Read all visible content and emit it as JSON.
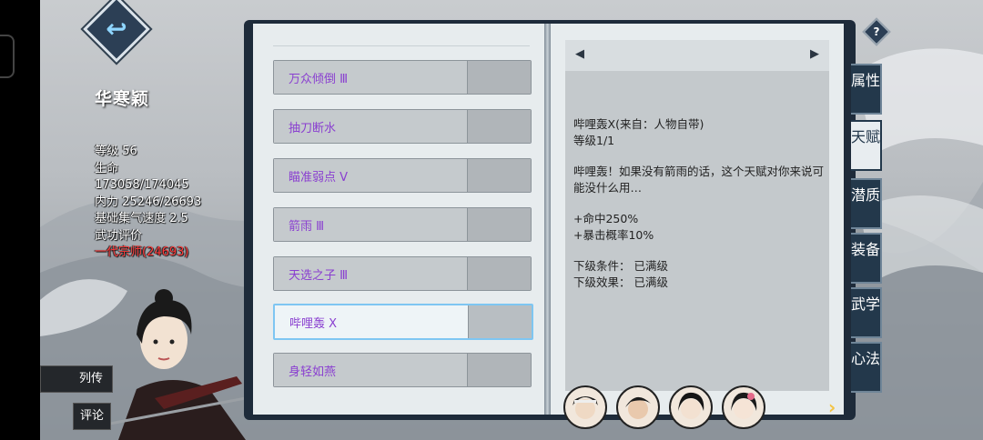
{
  "header": {
    "back_icon": "back-arrow-icon",
    "help_icon": "?"
  },
  "character": {
    "name": "华寒颖",
    "stats": [
      "等级 56",
      "生命",
      "173058/174045",
      "内力 25246/26693",
      "基础集气速度 2.5",
      "武功评价"
    ],
    "rank": "一代宗师(24693)"
  },
  "side_buttons": {
    "bio": "列传",
    "comment": "评论"
  },
  "talents": [
    {
      "name": "万众倾倒 Ⅲ"
    },
    {
      "name": "抽刀断水"
    },
    {
      "name": "瞄准弱点 Ⅴ"
    },
    {
      "name": "箭雨 Ⅲ"
    },
    {
      "name": "天选之子 Ⅲ"
    },
    {
      "name": "哔哩轰 Ⅹ"
    },
    {
      "name": "身轻如燕"
    }
  ],
  "detail": {
    "title": "哔哩轰Ⅹ(来自：人物自带)",
    "level": "等级1/1",
    "description": "哔哩轰！如果没有箭雨的话，这个天赋对你来说可能没什么用…",
    "effect_1": "+命中250%",
    "effect_2": "+暴击概率10%",
    "next_condition": "下级条件： 已满级",
    "next_effect": "下级效果： 已满级"
  },
  "tabs": [
    {
      "label": "属性"
    },
    {
      "label": "天赋"
    },
    {
      "label": "潜质"
    },
    {
      "label": "装备"
    },
    {
      "label": "武学"
    },
    {
      "label": "心法"
    }
  ],
  "colors": {
    "accent": "#8a3fd0",
    "rank": "#ff3b3b",
    "panel": "#23384b"
  }
}
